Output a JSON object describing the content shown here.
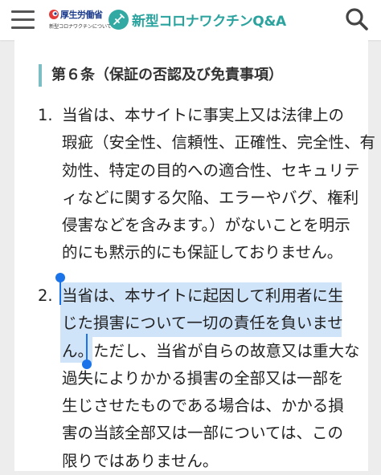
{
  "header": {
    "menu_icon": "hamburger-icon",
    "ministry_name": "厚生労働省",
    "ministry_sub": "新型コロナワクチンについて",
    "site_title": "新型コロナワクチンQ&A",
    "search_icon": "search-icon"
  },
  "article": {
    "heading": "第６条（保証の否認及び免責事項）",
    "clauses": [
      {
        "number": "1.",
        "lines": [
          "当省は、本サイトに事実上又は法律上の",
          "瑕疵（安全性、信頼性、正確性、完全性、有",
          "効性、特定の目的への適合性、セキュリテ",
          "ィなどに関する欠陥、エラーやバグ、権利",
          "侵害などを含みます。）がないことを明示",
          "的にも黙示的にも保証しておりません。"
        ]
      },
      {
        "number": "2.",
        "line1": "当省は、本サイトに起因して利用者に生",
        "line2": "じた損害について一切の責任を負いませ",
        "line3_selected": "ん。",
        "line3_rest": "ただし、当省が自らの故意又は重大な",
        "rest_lines": [
          "過失によりかかる損害の全部又は一部を",
          "生じさせたものである場合は、かかる損",
          "害の当該全部又は一部については、この",
          "限りではありません。"
        ]
      }
    ]
  },
  "colors": {
    "accent_teal": "#2aa39e",
    "selection": "#cfe3f9",
    "selection_handle": "#1a73e8"
  }
}
